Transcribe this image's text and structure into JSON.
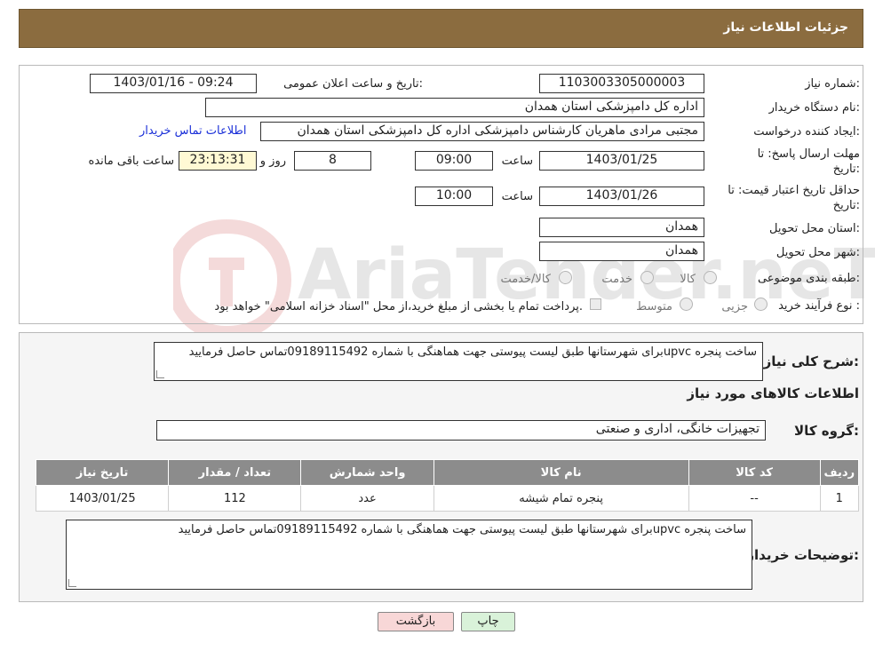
{
  "header": {
    "title": "جزئیات اطلاعات نیاز"
  },
  "fields": {
    "need_number_label": "شماره نیاز:",
    "need_number": "1103003305000003",
    "announce_label": "تاریخ و ساعت اعلان عمومی:",
    "announce_value": "1403/01/16 - 09:24",
    "buyer_org_label": "نام دستگاه خریدار:",
    "buyer_org": "اداره کل دامپزشکی استان همدان",
    "creator_label": "ایجاد کننده درخواست:",
    "creator": "مجتبی مرادی ماهریان کارشناس دامپزشکی اداره کل دامپزشکی استان همدان",
    "buyer_contact_link": "اطلاعات تماس خریدار",
    "deadline_label_1": "مهلت ارسال پاسخ: تا",
    "deadline_label_2": "تاریخ:",
    "deadline_date": "1403/01/25",
    "time_label": "ساعت",
    "deadline_time": "09:00",
    "days_value": "8",
    "days_label": "روز و",
    "remaining_time": "23:13:31",
    "remaining_label": "ساعت باقی مانده",
    "validity_label_1": "حداقل تاریخ اعتبار قیمت: تا",
    "validity_label_2": "تاریخ:",
    "validity_date": "1403/01/26",
    "validity_time": "10:00",
    "province_label": "استان محل تحویل:",
    "province": "همدان",
    "city_label": "شهر محل تحویل:",
    "city": "همدان",
    "category_label": "طبقه بندی موضوعی:",
    "category_options": [
      "کالا",
      "خدمت",
      "کالا/خدمت"
    ],
    "process_label": "نوع فرآیند خرید :",
    "process_options": [
      "جزیی",
      "متوسط"
    ],
    "payment_note": "پرداخت تمام یا بخشی از مبلغ خرید،از محل \"اسناد خزانه اسلامی\" خواهد بود."
  },
  "description": {
    "label": "شرح کلی نیاز:",
    "text": "ساخت پنجره upvcبرای شهرستانها طبق لیست پیوستی جهت هماهنگی با شماره 09189115492تماس حاصل فرمایید"
  },
  "goods": {
    "section_title": "اطلاعات کالاهای مورد نیاز",
    "group_label": "گروه کالا:",
    "group_value": "تجهیزات خانگی، اداری و صنعتی",
    "columns": [
      "ردیف",
      "کد کالا",
      "نام کالا",
      "واحد شمارش",
      "تعداد / مقدار",
      "تاریخ نیاز"
    ],
    "rows": [
      [
        "1",
        "--",
        "پنجره تمام شیشه",
        "عدد",
        "112",
        "1403/01/25"
      ]
    ]
  },
  "buyer_notes": {
    "label": "توضیحات خریدار:",
    "text": "ساخت پنجره upvcبرای شهرستانها طبق لیست پیوستی جهت هماهنگی با شماره 09189115492تماس حاصل فرمایید"
  },
  "buttons": {
    "print": "چاپ",
    "back": "بازگشت"
  },
  "watermark": {
    "text": "AriaTender.neT"
  },
  "colors": {
    "header": "#8b6c3f",
    "table_header": "#8c8c8c",
    "link": "#1a2fd8",
    "back_button": "#f8d7d7",
    "print_button": "#d9f2d9"
  }
}
